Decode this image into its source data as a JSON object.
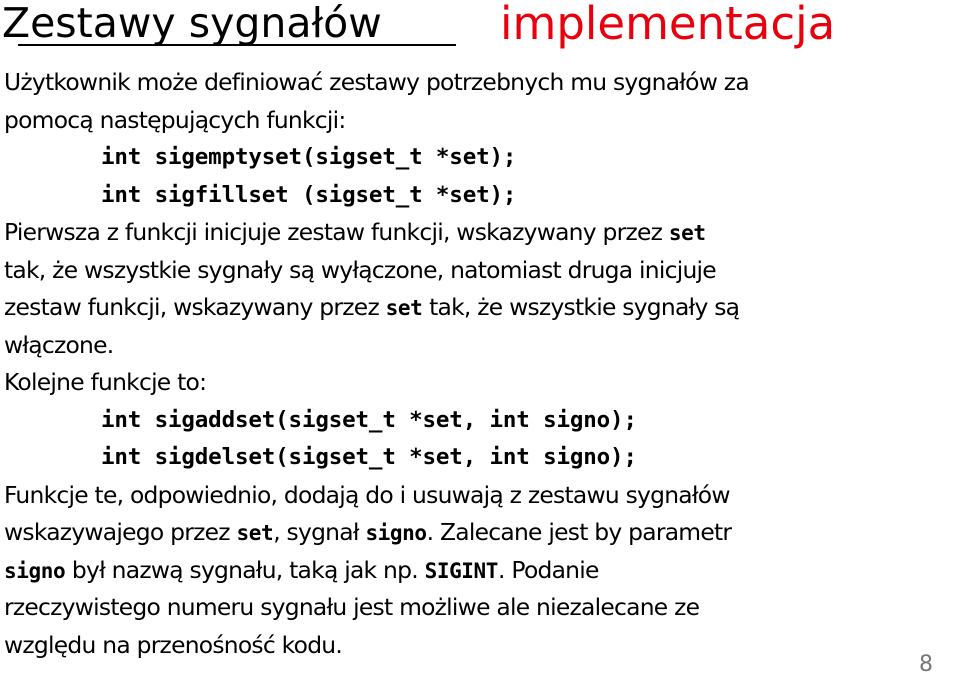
{
  "title": {
    "left": "Zestawy sygnałów",
    "right": "implementacja",
    "right_color": "#e8000d"
  },
  "paragraphs": {
    "intro_l1": "Użytkownik może definiować zestawy potrzebnych mu sygnałów za",
    "intro_l2": "pomocą następujących funkcji:",
    "code1": "int sigemptyset(sigset_t *set);",
    "code2": "int sigfillset (sigset_t *set);",
    "p2_l1_a": "Pierwsza z funkcji inicjuje zestaw funkcji, wskazywany przez ",
    "p2_l1_code": "set",
    "p2_l2": "tak, że wszystkie sygnały są wyłączone, natomiast druga inicjuje",
    "p2_l3_a": "zestaw funkcji, wskazywany przez ",
    "p2_l3_code": "set",
    "p2_l3_b": " tak, że wszystkie sygnały są",
    "p2_l4": "włączone.",
    "p3_l1": "Kolejne funkcje to:",
    "code3": "int sigaddset(sigset_t *set, int signo);",
    "code4": "int sigdelset(sigset_t *set, int signo);",
    "p4_l1": "Funkcje te, odpowiednio, dodają do i usuwają z zestawu sygnałów",
    "p4_l2_a": "wskazywajego przez ",
    "p4_l2_code1": "set",
    "p4_l2_b": ", sygnał ",
    "p4_l2_code2": "signo",
    "p4_l2_c": ". Zalecane jest by parametr",
    "p4_l3_code1": "signo",
    "p4_l3_a": " był nazwą sygnału, taką jak np. ",
    "p4_l3_code2": "SIGINT",
    "p4_l3_b": ". Podanie",
    "p4_l4": "rzeczywistego numeru sygnału jest możliwe ale niezalecane ze",
    "p4_l5": "względu na przenośność kodu."
  },
  "page_number": "8"
}
